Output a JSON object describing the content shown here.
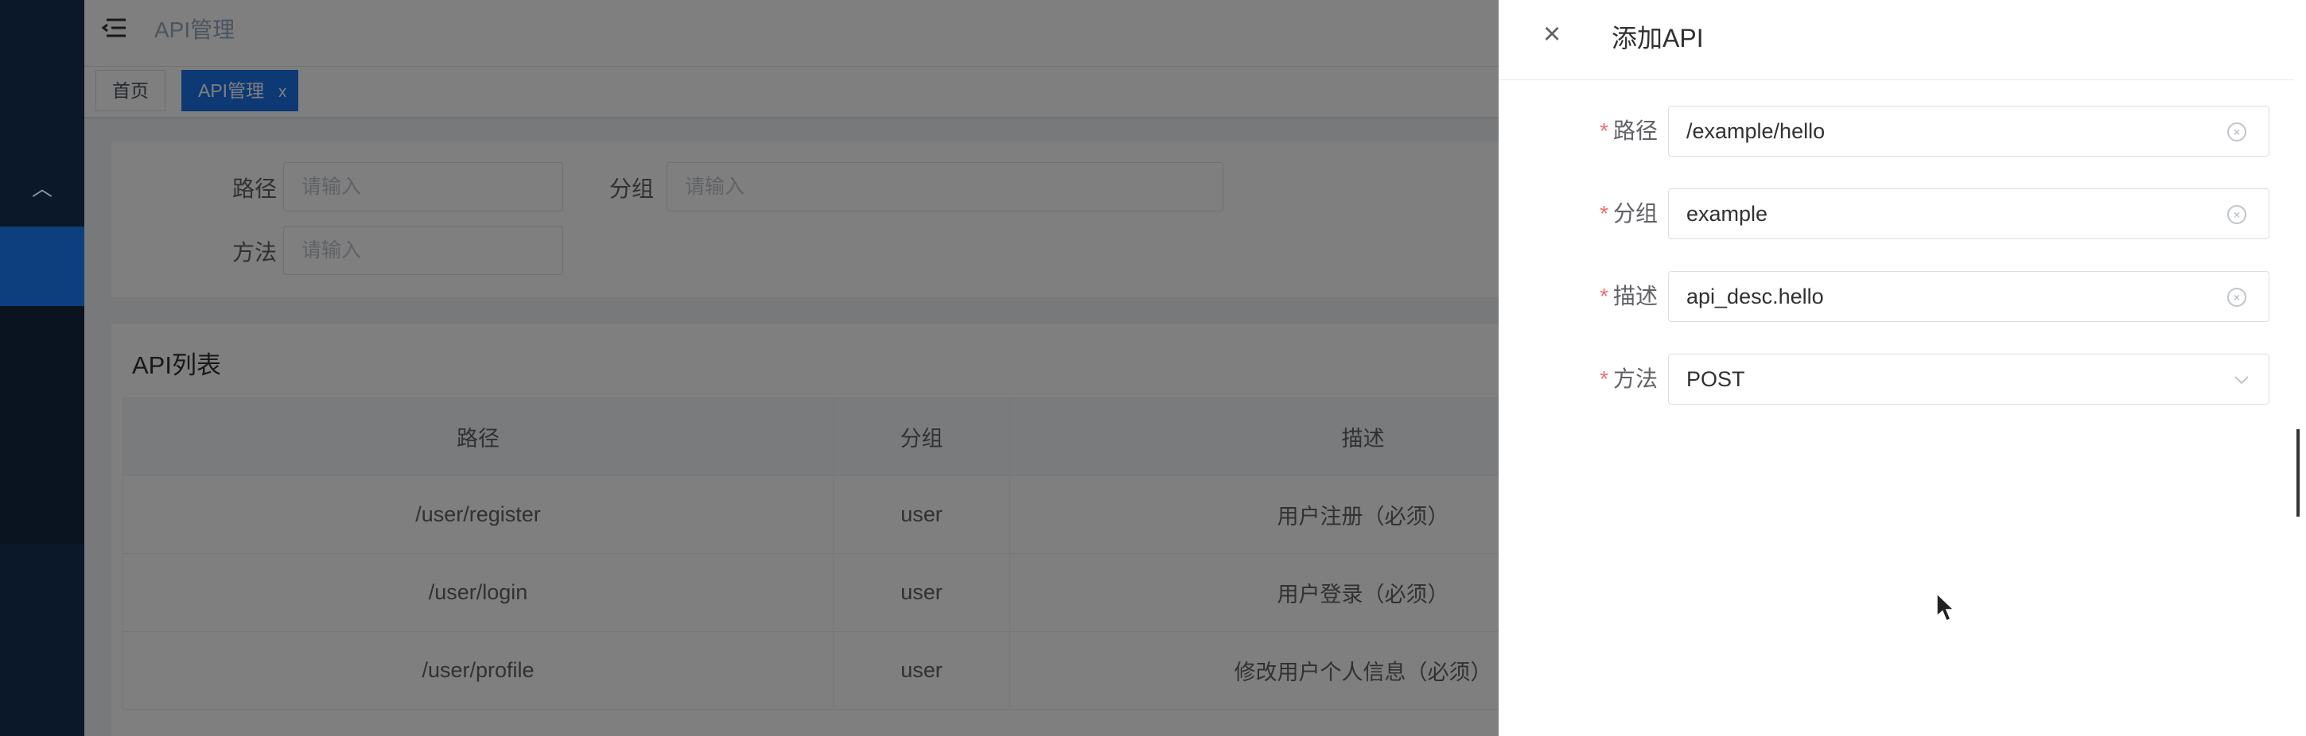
{
  "header": {
    "page_title": "API管理",
    "menu_icon": "hamburger-fold-icon"
  },
  "tabs": [
    {
      "label": "首页"
    },
    {
      "label": "API管理",
      "close": "x"
    }
  ],
  "search": {
    "path_label": "路径",
    "path_placeholder": "请输入",
    "group_label": "分组",
    "group_placeholder": "请输入",
    "method_label": "方法",
    "method_placeholder": "请输入"
  },
  "list": {
    "title": "API列表",
    "columns": [
      "路径",
      "分组",
      "描述"
    ],
    "rows": [
      {
        "path": "/user/register",
        "group": "user",
        "desc": "用户注册（必须）"
      },
      {
        "path": "/user/login",
        "group": "user",
        "desc": "用户登录（必须）"
      },
      {
        "path": "/user/profile",
        "group": "user",
        "desc": "修改用户个人信息（必须）"
      }
    ]
  },
  "drawer": {
    "title": "添加API",
    "close_icon": "×",
    "fields": [
      {
        "label": "路径",
        "value": "/example/hello",
        "required": "*"
      },
      {
        "label": "分组",
        "value": "example",
        "required": "*"
      },
      {
        "label": "描述",
        "value": "api_desc.hello",
        "required": "*"
      },
      {
        "label": "方法",
        "value": "POST",
        "required": "*"
      }
    ]
  },
  "colors": {
    "primary": "#1a73e8",
    "sidebar": "#0b1829",
    "required": "#f56c6c"
  }
}
